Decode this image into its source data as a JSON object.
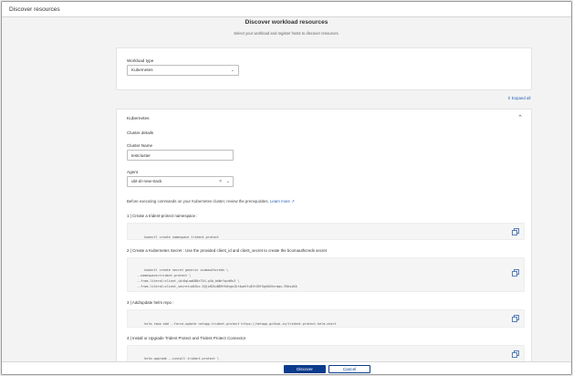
{
  "window": {
    "title": "Discover resources"
  },
  "header": {
    "title": "Discover workload resources",
    "subtitle": "Select your workload and register hosts to discover resources."
  },
  "workload": {
    "label": "Workload type",
    "selected": "Kubernetes"
  },
  "expand_all": "Expand all",
  "kubernetes": {
    "title": "Kubernetes",
    "section": "Cluster details",
    "cluster_name_label": "Cluster Name",
    "cluster_name_value": "testcluster",
    "agent_label": "Agent",
    "agent_value": "ubt-dr-new-track",
    "note": "Before executing commands on your Kubernetes cluster, review the prerequisites.",
    "note_link": "Learn more",
    "steps": [
      {
        "title": "1 | Create a trident-protect namespace :",
        "code": "kubectl create namespace trident-protect"
      },
      {
        "title": "2 | Create a Kubernetes Secret : Use the provided client_id and client_secret to create the bcomauthcreds secret",
        "code": "kubectl create secret generic scomauthcreds \\\n  --namespace=trident-protect \\\n  --from-literal=client_id=KqLmaD8NrT4X-p5b_bhWrYqcdRn3 \\\n  --from-literal=client_secret=a8Jbc-5QjoH2kvBD9fh6vgeJUr4wmYtuEVrO9f5gh0XVnrmqx-9VbsvKA"
      },
      {
        "title": "3 | Add/update helm repo :",
        "code": "helm repo add --force-update netapp-trident-protect https://netapp.github.io/trident-protect-helm-chart"
      },
      {
        "title": "4 | Install or Upgrade Trident Protect and Trident Protect Connector",
        "code": "helm upgrade --install trident-protect \\\n  netapp-trident-protect/trident-protect-console \\"
      }
    ]
  },
  "footer": {
    "primary": "Discover",
    "secondary": "Cancel"
  },
  "icons": {
    "chevron_down": "chevron-down-icon",
    "chevron_up": "chevron-up-icon",
    "copy": "copy-icon",
    "clear": "clear-icon",
    "external_link": "external-link-icon"
  },
  "colors": {
    "accent": "#0b3b8c",
    "link": "#1f5fb4"
  }
}
